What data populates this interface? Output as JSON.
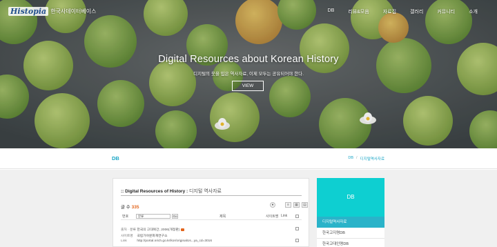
{
  "header": {
    "logo_text": "Histopia",
    "logo_subtitle": "한국사데이터베이스",
    "nav": [
      "DB",
      "리뷰&모음",
      "자료집",
      "갤러리",
      "커뮤니티",
      "소개"
    ]
  },
  "hero": {
    "title": "Digital Resources about Korean History",
    "description": "디지털의 옷을 입은 역사자료, 이제 모두는 공유되어야 한다.",
    "button_label": "VIEW"
  },
  "breadcrumb": {
    "section_title": "DB",
    "path": [
      "DB",
      "/",
      "디지털역사자료"
    ]
  },
  "panel": {
    "title_en": ":: Digital Resources of History :",
    "title_ko": "디지털 역사자료",
    "count_label": "글 수",
    "count_value": "335",
    "filter": {
      "label_no": "번호",
      "select_value": "분류",
      "go_label": "Go",
      "col_title": "제목",
      "col_site": "사이트명",
      "col_url": "Link"
    },
    "rows": [
      {
        "label": "출처 · 분류",
        "value": "한국의 고대목간, 2006(개정판)"
      },
      {
        "label": "사이트명",
        "value": "국립가야문화재연구소"
      },
      {
        "label": "Link",
        "value": "http://portal.nrich.go.kr/kor/originalUs...ya_cd=3016"
      }
    ]
  },
  "sidebar": {
    "heading": "DB",
    "items": [
      "디지털역사자료",
      "한국고지명DB",
      "한국고대인명DB"
    ]
  },
  "colors": {
    "accent": "#1aa6c6",
    "sidebar_heading": "#0ecfd1",
    "sidebar_active": "#2ab3c9",
    "count_highlight": "#e2651d"
  }
}
